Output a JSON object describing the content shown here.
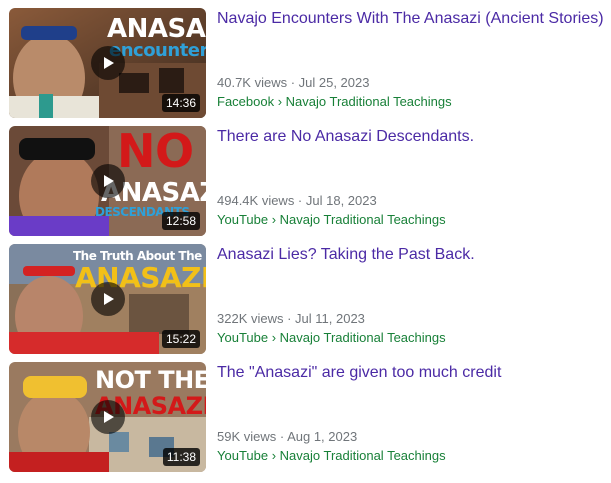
{
  "colors": {
    "title": "#4b2aa5",
    "meta": "#70757a",
    "source": "#188038"
  },
  "results": [
    {
      "title": "Navajo Encounters With The Anasazi (Ancient Stories)",
      "meta": "40.7K views · Jul 25, 2023",
      "source": "Facebook › Navajo Traditional Teachings",
      "duration": "14:36",
      "thumb_line1": "ANASAZI",
      "thumb_line2": "encounters"
    },
    {
      "title": "There are No Anasazi Descendants.",
      "meta": "494.4K views · Jul 18, 2023",
      "source": "YouTube › Navajo Traditional Teachings",
      "duration": "12:58",
      "thumb_line1": "NO",
      "thumb_line2": "ANASAZI",
      "thumb_line3": "DESCENDANTS"
    },
    {
      "title": "Anasazi Lies? Taking the Past Back.",
      "meta": "322K views · Jul 11, 2023",
      "source": "YouTube › Navajo Traditional Teachings",
      "duration": "15:22",
      "thumb_line1": "The Truth About The",
      "thumb_line2": "ANASAZI"
    },
    {
      "title": "The \"Anasazi\" are given too much credit",
      "meta": "59K views · Aug 1, 2023",
      "source": "YouTube › Navajo Traditional Teachings",
      "duration": "11:38",
      "thumb_line1": "NOT THE",
      "thumb_line2": "ANASAZI"
    }
  ]
}
